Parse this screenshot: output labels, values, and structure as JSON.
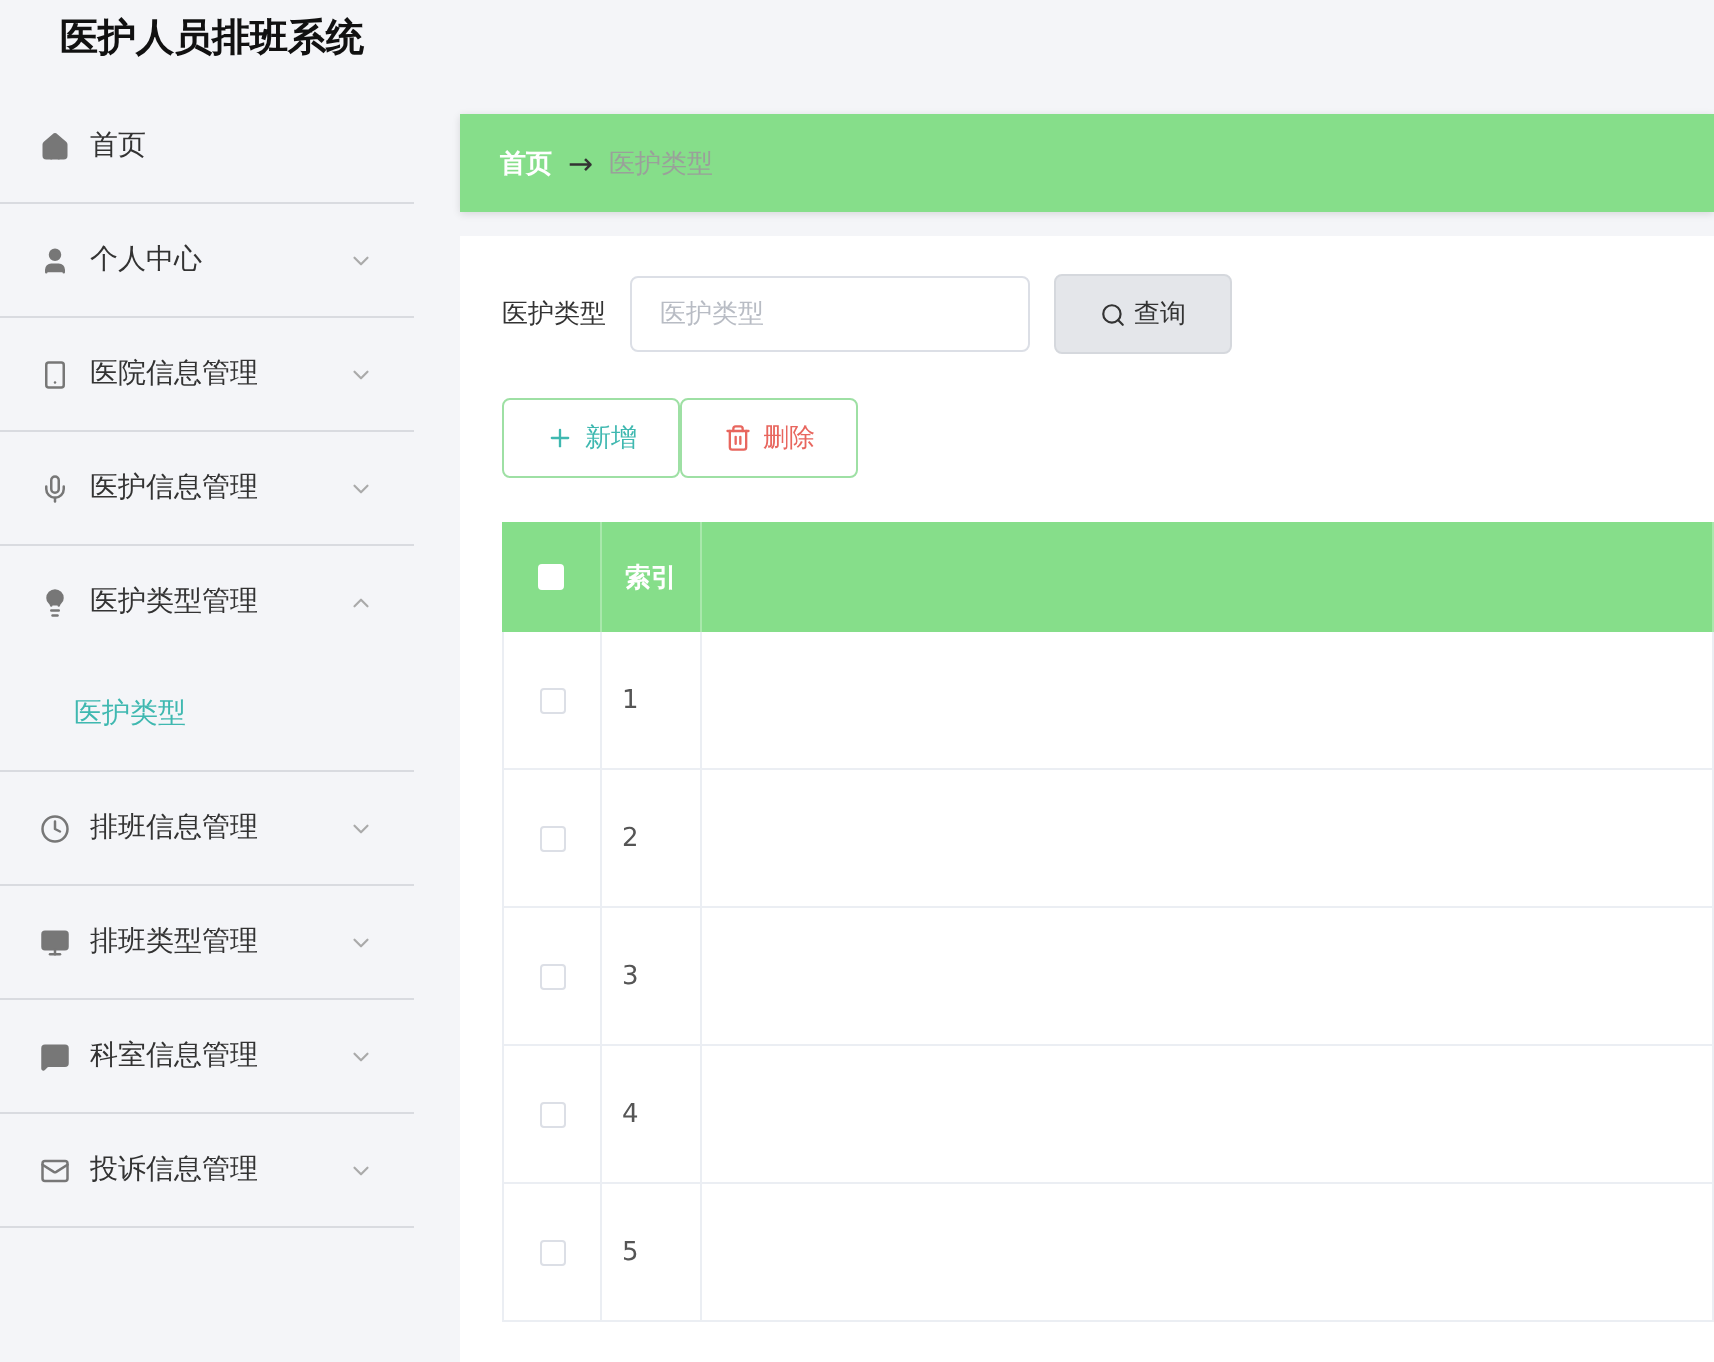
{
  "app_title": "医护人员排班系统",
  "sidebar": {
    "items": [
      {
        "label": "首页",
        "kind": "link"
      },
      {
        "label": "个人中心",
        "kind": "menu",
        "expanded": false
      },
      {
        "label": "医院信息管理",
        "kind": "menu",
        "expanded": false
      },
      {
        "label": "医护信息管理",
        "kind": "menu",
        "expanded": false
      },
      {
        "label": "医护类型管理",
        "kind": "menu",
        "expanded": true,
        "children": [
          {
            "label": "医护类型",
            "selected": true
          }
        ]
      },
      {
        "label": "排班信息管理",
        "kind": "menu",
        "expanded": false
      },
      {
        "label": "排班类型管理",
        "kind": "menu",
        "expanded": false
      },
      {
        "label": "科室信息管理",
        "kind": "menu",
        "expanded": false
      },
      {
        "label": "投诉信息管理",
        "kind": "menu",
        "expanded": false
      }
    ]
  },
  "breadcrumb": {
    "items": [
      "首页",
      "医护类型"
    ],
    "separator": "→"
  },
  "search": {
    "label": "医护类型",
    "placeholder": "医护类型",
    "button": "查询"
  },
  "actions": [
    {
      "label": "新增",
      "kind": "add"
    },
    {
      "label": "删除",
      "kind": "delete"
    }
  ],
  "table": {
    "header_checked": false,
    "columns": [
      "索引"
    ],
    "rows": [
      {
        "index": "1",
        "checked": false
      },
      {
        "index": "2",
        "checked": false
      },
      {
        "index": "3",
        "checked": false
      },
      {
        "index": "4",
        "checked": false
      },
      {
        "index": "5",
        "checked": false
      }
    ]
  }
}
